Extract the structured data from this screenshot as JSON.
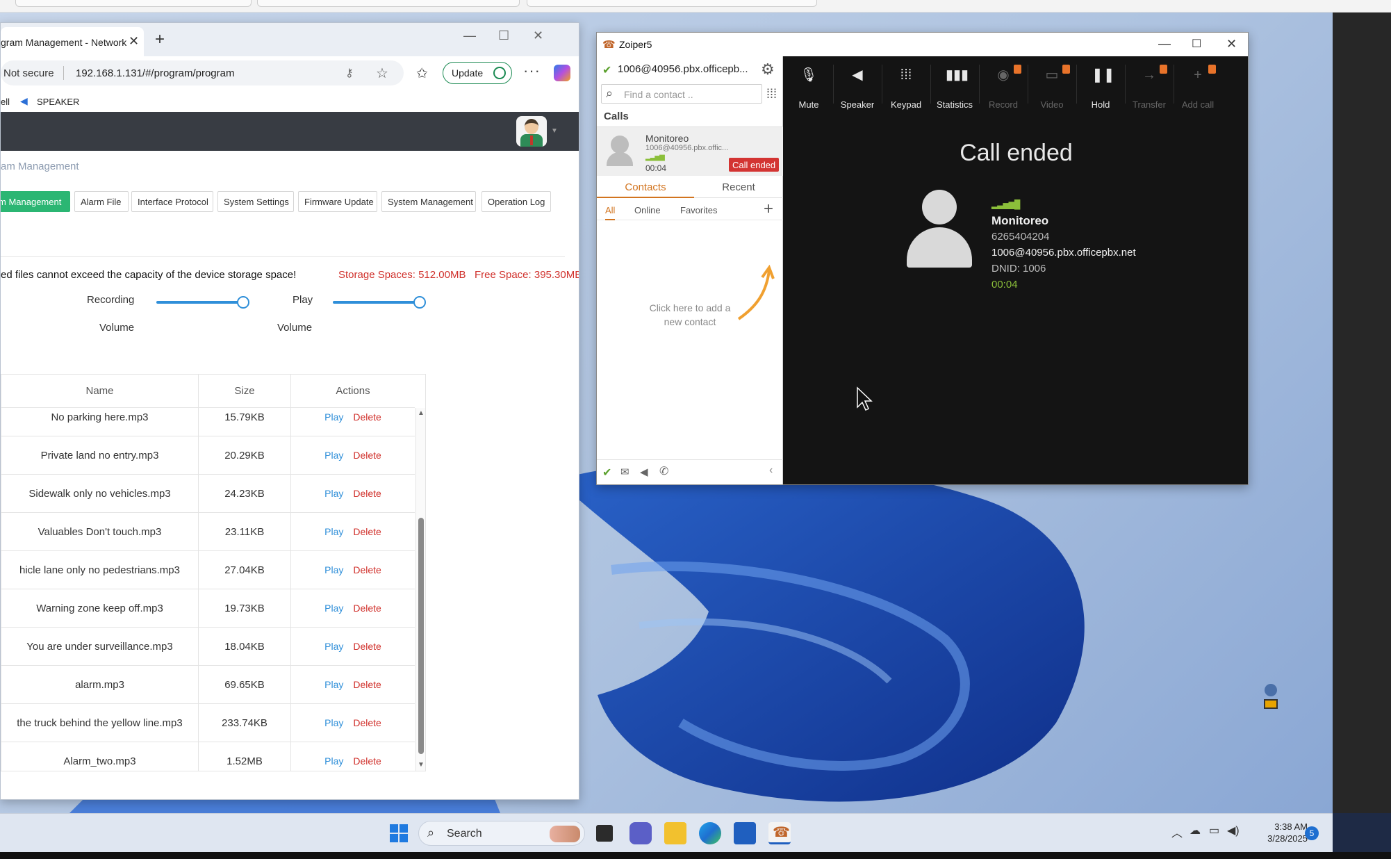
{
  "browser": {
    "tab_title": "gram Management - Network",
    "not_secure": "Not secure",
    "url": "192.168.1.131/#/program/program",
    "update_label": "Update",
    "fav_partial": "ell",
    "fav_speaker": "SPEAKER"
  },
  "page": {
    "breadcrumb": "am Management",
    "tabs": [
      "m Management",
      "Alarm File",
      "Interface Protocol",
      "System Settings",
      "Firmware Update",
      "System Management",
      "Operation Log"
    ],
    "active_tab_index": 0,
    "warning": "ed files cannot exceed the capacity of the device storage space!",
    "storage_label": "Storage Spaces: 512.00MB",
    "free_label": "Free Space: 395.30MB",
    "recording_label": "Recording",
    "play_label": "Play",
    "volume_label": "Volume",
    "recording_volume": 0.95,
    "play_volume": 0.95
  },
  "files": {
    "headers": {
      "name": "Name",
      "size": "Size",
      "actions": "Actions"
    },
    "play_label": "Play",
    "delete_label": "Delete",
    "rows": [
      {
        "name": "No parking here.mp3",
        "size": "15.79KB"
      },
      {
        "name": "Private land no entry.mp3",
        "size": "20.29KB"
      },
      {
        "name": "Sidewalk only no vehicles.mp3",
        "size": "24.23KB"
      },
      {
        "name": "Valuables Don't touch.mp3",
        "size": "23.11KB"
      },
      {
        "name": "hicle lane only no pedestrians.mp3",
        "size": "27.04KB"
      },
      {
        "name": "Warning zone keep off.mp3",
        "size": "19.73KB"
      },
      {
        "name": "You are under surveillance.mp3",
        "size": "18.04KB"
      },
      {
        "name": "alarm.mp3",
        "size": "69.65KB"
      },
      {
        "name": "the truck behind the yellow line.mp3",
        "size": "233.74KB"
      },
      {
        "name": "Alarm_two.mp3",
        "size": "1.52MB"
      }
    ]
  },
  "zoiper": {
    "title": "Zoiper5",
    "account": "1006@40956.pbx.officepb...",
    "find_placeholder": "Find a contact ..",
    "calls_label": "Calls",
    "call_item": {
      "name": "Monitoreo",
      "address": "1006@40956.pbx.offic...",
      "duration": "00:04",
      "status": "Call ended"
    },
    "contact_tabs": [
      "Contacts",
      "Recent"
    ],
    "filter_tabs": [
      "All",
      "Online",
      "Favorites"
    ],
    "add_contact_hint": "Click here to add a new contact",
    "toolbar": [
      {
        "label": "Mute",
        "icon": "mute-icon",
        "enabled": true,
        "badge": false
      },
      {
        "label": "Speaker",
        "icon": "speaker-icon",
        "enabled": true,
        "badge": false
      },
      {
        "label": "Keypad",
        "icon": "keypad-icon",
        "enabled": true,
        "badge": false
      },
      {
        "label": "Statistics",
        "icon": "statistics-icon",
        "enabled": true,
        "badge": false
      },
      {
        "label": "Record",
        "icon": "record-icon",
        "enabled": false,
        "badge": true
      },
      {
        "label": "Video",
        "icon": "video-icon",
        "enabled": false,
        "badge": true
      },
      {
        "label": "Hold",
        "icon": "hold-icon",
        "enabled": true,
        "badge": false
      },
      {
        "label": "Transfer",
        "icon": "transfer-icon",
        "enabled": false,
        "badge": true
      },
      {
        "label": "Add call",
        "icon": "add-call-icon",
        "enabled": false,
        "badge": true
      }
    ],
    "call_state": "Call ended",
    "contact": {
      "name": "Monitoreo",
      "number": "6265404204",
      "address": "1006@40956.pbx.officepbx.net",
      "dnid": "DNID: 1006",
      "duration": "00:04"
    },
    "accent": "#8bbf3a",
    "badge_color": "#d33432"
  },
  "taskbar": {
    "search_label": "Search",
    "time": "3:38 AM",
    "date": "3/28/2025",
    "notification_count": "5"
  }
}
